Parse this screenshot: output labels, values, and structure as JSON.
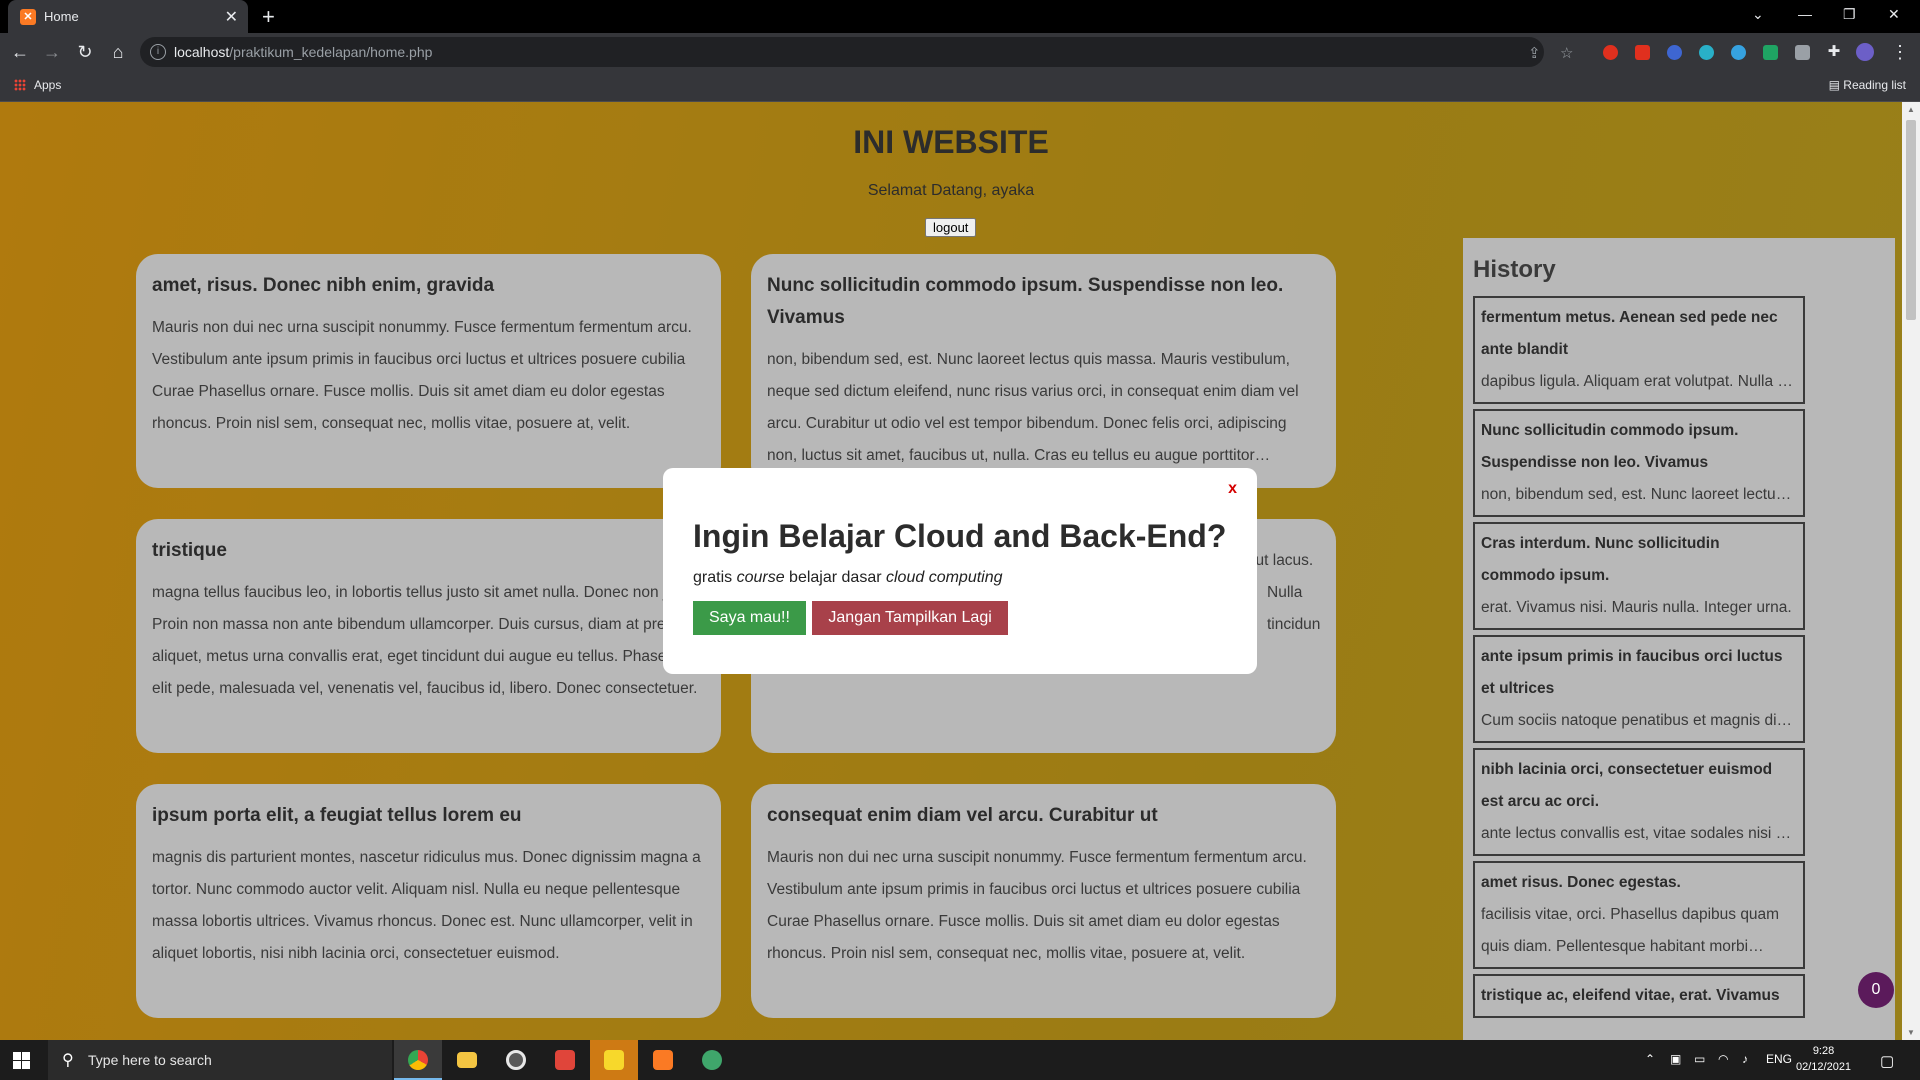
{
  "browser": {
    "tab_title": "Home",
    "tab_favicon": "xampp-icon",
    "url_host": "localhost",
    "url_path": "/praktikum_kedelapan/home.php",
    "bookmarks_apps": "Apps",
    "reading_list": "Reading list"
  },
  "page": {
    "title": "INI WEBSITE",
    "welcome": "Selamat Datang, ayaka",
    "logout_label": "logout"
  },
  "cards": [
    {
      "title": "amet, risus. Donec nibh enim, gravida",
      "body": "Mauris non dui nec urna suscipit nonummy. Fusce fermentum fermentum arcu. Vestibulum ante ipsum primis in faucibus orci luctus et ultrices posuere cubilia Curae Phasellus ornare. Fusce mollis. Duis sit amet diam eu dolor egestas rhoncus. Proin nisl sem, consequat nec, mollis vitae, posuere at, velit."
    },
    {
      "title": "Nunc sollicitudin commodo ipsum. Suspendisse non leo. Vivamus",
      "body": "non, bibendum sed, est. Nunc laoreet lectus quis massa. Mauris vestibulum, neque sed dictum eleifend, nunc risus varius orci, in consequat enim diam vel arcu. Curabitur ut odio vel est tempor bibendum. Donec felis orci, adipiscing non, luctus sit amet, faucibus ut, nulla. Cras eu tellus eu augue porttitor interdum."
    },
    {
      "title": "tristique",
      "body": "magna tellus faucibus leo, in lobortis tellus justo sit amet nulla. Donec non justo. Proin non massa non ante bibendum ullamcorper. Duis cursus, diam at pretium aliquet, metus urna convallis erat, eget tincidunt dui augue eu tellus. Phasellus elit pede, malesuada vel, venenatis vel, faucibus id, libero. Donec consectetuer."
    },
    {
      "title": "",
      "body": "re ttitor auris eu turpis. Nulla aliquet. Proin velit. Sed malesuada augue ut lacus. Nulla tincidunt."
    },
    {
      "title": "ipsum porta elit, a feugiat tellus lorem eu",
      "body": "magnis dis parturient montes, nascetur ridiculus mus. Donec dignissim magna a tortor. Nunc commodo auctor velit. Aliquam nisl. Nulla eu neque pellentesque massa lobortis ultrices. Vivamus rhoncus. Donec est. Nunc ullamcorper, velit in aliquet lobortis, nisi nibh lacinia orci, consectetuer euismod."
    },
    {
      "title": "consequat enim diam vel arcu. Curabitur ut",
      "body": "Mauris non dui nec urna suscipit nonummy. Fusce fermentum fermentum arcu. Vestibulum ante ipsum primis in faucibus orci luctus et ultrices posuere cubilia Curae Phasellus ornare. Fusce mollis. Duis sit amet diam eu dolor egestas rhoncus. Proin nisl sem, consequat nec, mollis vitae, posuere at, velit."
    }
  ],
  "history": {
    "heading": "History",
    "items": [
      {
        "title": "fermentum metus. Aenean sed pede nec ante blandit",
        "body": "dapibus ligula. Aliquam erat volutpat. Nulla dignissim."
      },
      {
        "title": "Nunc sollicitudin commodo ipsum. Suspendisse non leo. Vivamus",
        "body": "non, bibendum sed, est. Nunc laoreet lectus quis massa."
      },
      {
        "title": "Cras interdum. Nunc sollicitudin commodo ipsum.",
        "body": "erat. Vivamus nisi. Mauris nulla. Integer urna."
      },
      {
        "title": "ante ipsum primis in faucibus orci luctus et ultrices",
        "body": "Cum sociis natoque penatibus et magnis dis parturient."
      },
      {
        "title": "nibh lacinia orci, consectetuer euismod est arcu ac orci.",
        "body": "ante lectus convallis est, vitae sodales nisi magna."
      },
      {
        "title": "amet risus. Donec egestas.",
        "body": "facilisis vitae, orci. Phasellus dapibus quam quis diam. Pellentesque habitant morbi tristique."
      },
      {
        "title": "tristique ac, eleifend vitae, erat. Vivamus",
        "body": ""
      }
    ]
  },
  "counter": "0",
  "modal": {
    "close": "x",
    "title": "Ingin Belajar Cloud and Back-End?",
    "text_1": "gratis ",
    "text_course": "course",
    "text_2": " belajar dasar ",
    "text_cloud": "cloud computing",
    "yes_label": "Saya mau!!",
    "no_label": "Jangan Tampilkan Lagi"
  },
  "taskbar": {
    "search_placeholder": "Type here to search",
    "lang": "ENG",
    "time": "9:28",
    "date": "02/12/2021"
  }
}
